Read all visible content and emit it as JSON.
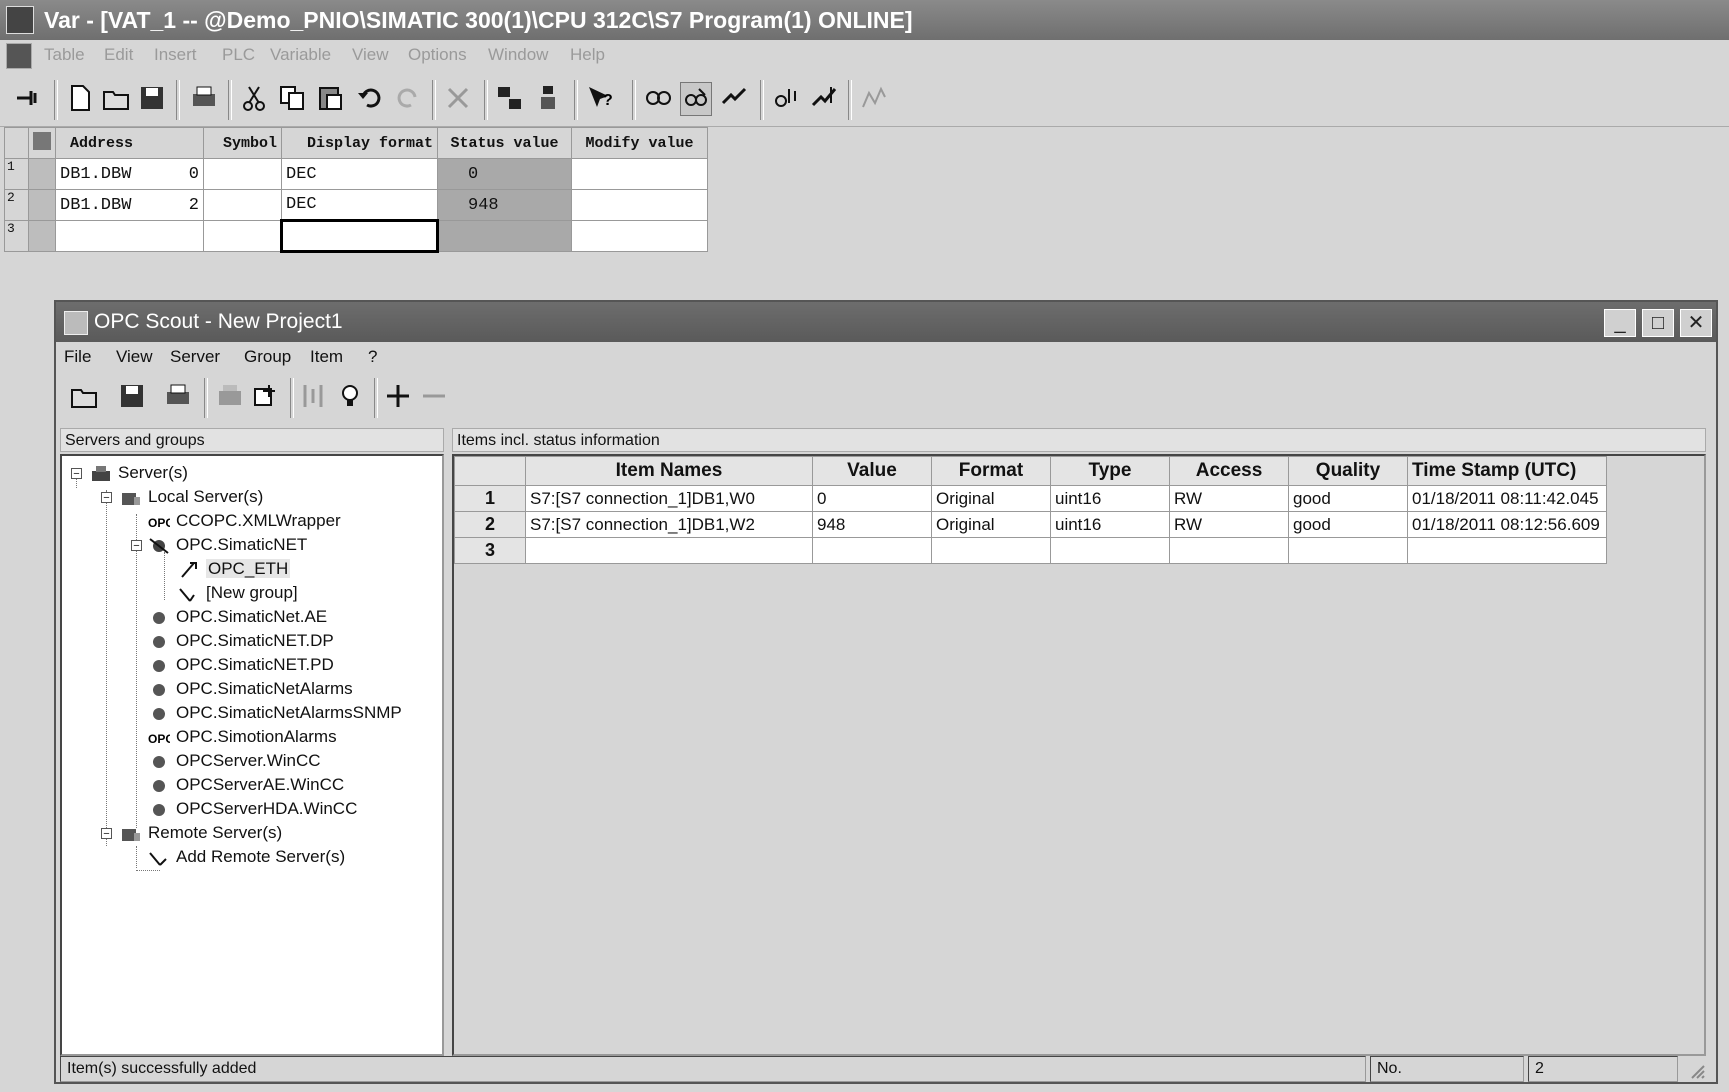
{
  "vat_window": {
    "title": "Var - [VAT_1 -- @Demo_PNIO\\SIMATIC 300(1)\\CPU 312C\\S7 Program(1)  ONLINE]",
    "menu": [
      "Table",
      "Edit",
      "Insert",
      "PLC",
      "Variable",
      "View",
      "Options",
      "Window",
      "Help"
    ],
    "columns": [
      "Address",
      "Symbol",
      "Display format",
      "Status value",
      "Modify value"
    ],
    "rows": [
      {
        "num": "1",
        "address": "DB1.DBW",
        "offset": "0",
        "symbol": "",
        "format": "DEC",
        "status": "0",
        "modify": ""
      },
      {
        "num": "2",
        "address": "DB1.DBW",
        "offset": "2",
        "symbol": "",
        "format": "DEC",
        "status": "948",
        "modify": ""
      },
      {
        "num": "3",
        "address": "",
        "offset": "",
        "symbol": "",
        "format": "",
        "status": "",
        "modify": ""
      }
    ]
  },
  "opc_window": {
    "title": "OPC Scout - New Project1",
    "menu": [
      "File",
      "View",
      "Server",
      "Group",
      "Item",
      "?"
    ],
    "servers_panel_title": "Servers and groups",
    "items_panel_title": "Items incl. status information",
    "tree": [
      {
        "label": "Server(s)",
        "icon": "server-group-icon"
      },
      {
        "label": "Local Server(s)",
        "icon": "local-server-icon"
      },
      {
        "label": "CCOPC.XMLWrapper",
        "icon": "opc-server-icon"
      },
      {
        "label": "OPC.SimaticNET",
        "icon": "opc-server-icon"
      },
      {
        "label": "OPC_ETH",
        "icon": "group-icon"
      },
      {
        "label": "[New group]",
        "icon": "new-group-icon"
      },
      {
        "label": "OPC.SimaticNet.AE",
        "icon": "opc-server-icon"
      },
      {
        "label": "OPC.SimaticNET.DP",
        "icon": "opc-server-icon"
      },
      {
        "label": "OPC.SimaticNET.PD",
        "icon": "opc-server-icon"
      },
      {
        "label": "OPC.SimaticNetAlarms",
        "icon": "opc-server-icon"
      },
      {
        "label": "OPC.SimaticNetAlarmsSNMP",
        "icon": "opc-server-icon"
      },
      {
        "label": "OPC.SimotionAlarms",
        "icon": "opc-server-icon"
      },
      {
        "label": "OPCServer.WinCC",
        "icon": "opc-server-icon"
      },
      {
        "label": "OPCServerAE.WinCC",
        "icon": "opc-server-icon"
      },
      {
        "label": "OPCServerHDA.WinCC",
        "icon": "opc-server-icon"
      },
      {
        "label": "Remote Server(s)",
        "icon": "remote-server-icon"
      },
      {
        "label": "Add Remote Server(s)",
        "icon": "add-remote-icon"
      }
    ],
    "items_columns": [
      "Item Names",
      "Value",
      "Format",
      "Type",
      "Access",
      "Quality",
      "Time Stamp (UTC)"
    ],
    "items": [
      {
        "num": "1",
        "name": "S7:[S7 connection_1]DB1,W0",
        "value": "0",
        "format": "Original",
        "type": "uint16",
        "access": "RW",
        "quality": "good",
        "timestamp": "01/18/2011 08:11:42.045"
      },
      {
        "num": "2",
        "name": "S7:[S7 connection_1]DB1,W2",
        "value": "948",
        "format": "Original",
        "type": "uint16",
        "access": "RW",
        "quality": "good",
        "timestamp": "01/18/2011 08:12:56.609"
      },
      {
        "num": "3",
        "name": "",
        "value": "",
        "format": "",
        "type": "",
        "access": "",
        "quality": "",
        "timestamp": ""
      }
    ],
    "status_message": "Item(s) successfully added",
    "status_no_label": "No.",
    "status_no_value": "2"
  }
}
